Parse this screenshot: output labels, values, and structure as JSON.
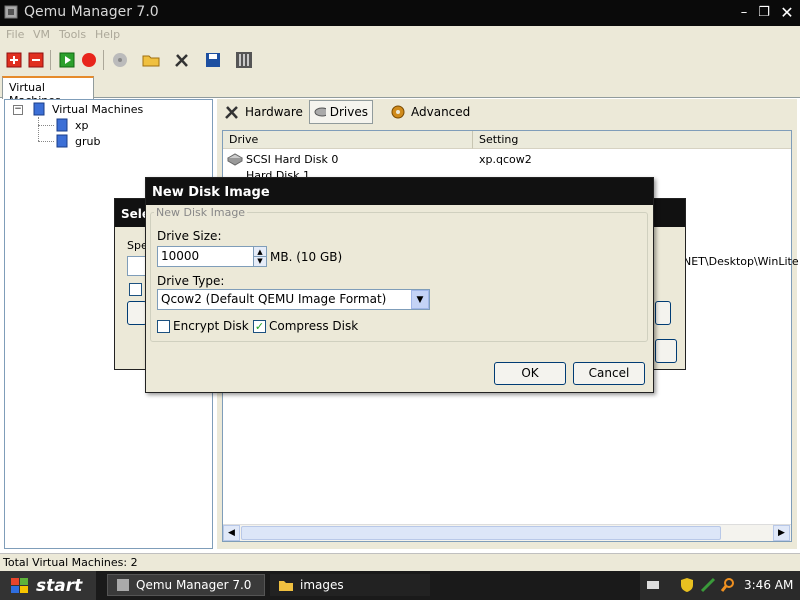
{
  "app": {
    "title": "Qemu Manager 7.0"
  },
  "menu": [
    "File",
    "VM",
    "Tools",
    "Help"
  ],
  "tabs": {
    "virtual_machines": "Virtual Machines"
  },
  "tree": {
    "root": "Virtual Machines",
    "items": [
      "xp",
      "grub"
    ]
  },
  "right_tabs": {
    "hardware": "Hardware",
    "drives": "Drives",
    "advanced": "Advanced"
  },
  "drives_table": {
    "headers": [
      "Drive",
      "Setting"
    ],
    "rows": [
      {
        "drive": "SCSI Hard Disk 0",
        "setting": "xp.qcow2"
      },
      {
        "drive": "Hard Disk 1",
        "setting": ""
      }
    ],
    "partial_path": "NET\\Desktop\\WinLite"
  },
  "status": {
    "text": "Total Virtual Machines: 2"
  },
  "back_dialog": {
    "title_partial": "Sele",
    "label_partial": "Spe"
  },
  "dialog": {
    "title": "New Disk Image",
    "group": "New Disk Image",
    "drive_size_label": "Drive Size:",
    "drive_size_value": "10000",
    "unit_label": "MB. (10 GB)",
    "drive_type_label": "Drive Type:",
    "drive_type_value": "Qcow2  (Default QEMU Image Format)",
    "encrypt_label": "Encrypt Disk",
    "encrypt_checked": false,
    "compress_label": "Compress Disk",
    "compress_checked": true,
    "ok_label": "OK",
    "cancel_label": "Cancel"
  },
  "taskbar": {
    "start": "start",
    "tasks": [
      "Qemu Manager 7.0",
      "images"
    ],
    "clock": "3:46 AM"
  }
}
